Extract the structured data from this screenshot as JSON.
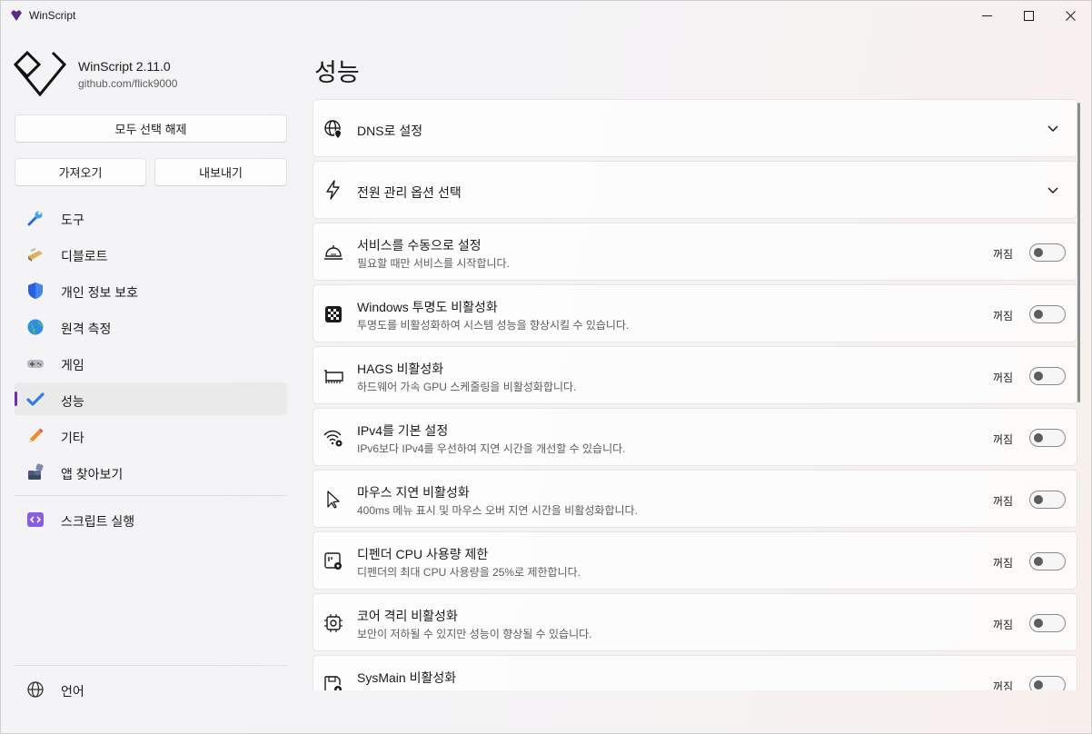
{
  "window": {
    "title": "WinScript",
    "accent": "#6b2fa8"
  },
  "sidebar": {
    "app_name": "WinScript 2.11.0",
    "app_link": "github.com/flick9000",
    "deselect_all": "모두 선택 해제",
    "import_label": "가져오기",
    "export_label": "내보내기",
    "items": [
      {
        "label": "도구",
        "icon": "wrench-icon"
      },
      {
        "label": "디블로트",
        "icon": "broom-icon"
      },
      {
        "label": "개인 정보 보호",
        "icon": "shield-icon"
      },
      {
        "label": "원격 측정",
        "icon": "globe-icon"
      },
      {
        "label": "게임",
        "icon": "gamepad-icon"
      },
      {
        "label": "성능",
        "icon": "checkmark-icon",
        "selected": true
      },
      {
        "label": "기타",
        "icon": "pencil-icon"
      },
      {
        "label": "앱 찾아보기",
        "icon": "apps-icon"
      }
    ],
    "run_script": "스크립트 실행",
    "language": "언어"
  },
  "main": {
    "title": "성능",
    "expanders": [
      {
        "title": "DNS로 설정",
        "icon": "globe-pin-icon"
      },
      {
        "title": "전원 관리 옵션 선택",
        "icon": "lightning-icon"
      }
    ],
    "settings": [
      {
        "title": "서비스를 수동으로 설정",
        "desc": "필요할 때만 서비스를 시작합니다.",
        "state": "꺼짐",
        "icon": "service-bell-icon"
      },
      {
        "title": "Windows 투명도 비활성화",
        "desc": "투명도를 비활성화하여 시스템 성능을 향상시킬 수 있습니다.",
        "state": "꺼짐",
        "icon": "checkerboard-icon"
      },
      {
        "title": "HAGS 비활성화",
        "desc": "하드웨어 가속 GPU 스케줄링을 비활성화합니다.",
        "state": "꺼짐",
        "icon": "gpu-card-icon"
      },
      {
        "title": "IPv4를 기본 설정",
        "desc": "IPv6보다 IPv4를 우선하여 지연 시간을 개선할 수 있습니다.",
        "state": "꺼짐",
        "icon": "wifi-settings-icon"
      },
      {
        "title": "마우스 지연 비활성화",
        "desc": "400ms 메뉴 표시 및 마우스 오버 지연 시간을 비활성화합니다.",
        "state": "꺼짐",
        "icon": "cursor-icon"
      },
      {
        "title": "디펜더 CPU 사용량 제한",
        "desc": "디펜더의 최대 CPU 사용량을 25%로 제한합니다.",
        "state": "꺼짐",
        "icon": "gauge-settings-icon"
      },
      {
        "title": "코어 격리 비활성화",
        "desc": "보안이 저하될 수 있지만 성능이 향상될 수 있습니다.",
        "state": "꺼짐",
        "icon": "chip-settings-icon"
      },
      {
        "title": "SysMain 비활성화",
        "desc": "",
        "state": "꺼짐",
        "icon": "drive-settings-icon"
      }
    ]
  }
}
